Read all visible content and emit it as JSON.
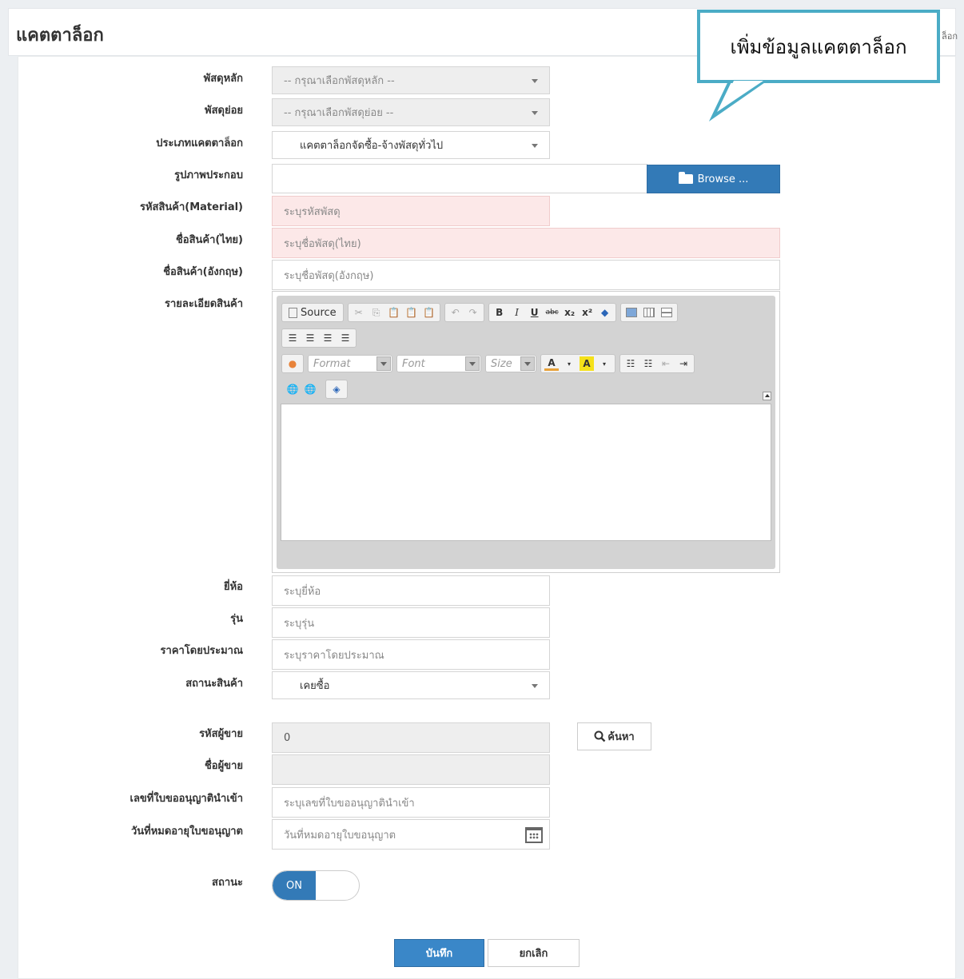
{
  "header": {
    "title": "แคตตาล็อก",
    "breadcrumb_tail": "ล็อก"
  },
  "callout": {
    "text": "เพิ่มข้อมูลแคตตาล็อก"
  },
  "form": {
    "main_item": {
      "label": "พัสดุหลัก",
      "placeholder": "-- กรุณาเลือกพัสดุหลัก --"
    },
    "sub_item": {
      "label": "พัสดุย่อย",
      "placeholder": "-- กรุณาเลือกพัสดุย่อย --"
    },
    "catalog_type": {
      "label": "ประเภทแคตตาล็อก",
      "value": "แคตตาล็อกจัดซื้อ-จ้างพัสดุทั่วไป"
    },
    "image": {
      "label": "รูปภาพประกอบ",
      "browse_label": "Browse ..."
    },
    "material_code": {
      "label": "รหัสสินค้า(Material)",
      "placeholder": "ระบุรหัสพัสดุ"
    },
    "name_th": {
      "label": "ชื่อสินค้า(ไทย)",
      "placeholder": "ระบุชื่อพัสดุ(ไทย)"
    },
    "name_en": {
      "label": "ชื่อสินค้า(อังกฤษ)",
      "placeholder": "ระบุชื่อพัสดุ(อังกฤษ)"
    },
    "details": {
      "label": "รายละเอียดสินค้า"
    },
    "brand": {
      "label": "ยี่ห้อ",
      "placeholder": "ระบุยี่ห้อ"
    },
    "model": {
      "label": "รุ่น",
      "placeholder": "ระบุรุ่น"
    },
    "price": {
      "label": "ราคาโดยประมาณ",
      "placeholder": "ระบุราคาโดยประมาณ"
    },
    "product_status": {
      "label": "สถานะสินค้า",
      "value": "เคยซื้อ"
    },
    "vendor_code": {
      "label": "รหัสผู้ขาย",
      "value": "0",
      "search_label": "ค้นหา"
    },
    "vendor_name": {
      "label": "ชื่อผู้ขาย",
      "value": ""
    },
    "license_no": {
      "label": "เลขที่ใบขออนุญาตินำเข้า",
      "placeholder": "ระบุเลขที่ใบขออนุญาตินำเข้า"
    },
    "license_expiry": {
      "label": "วันที่หมดอายุใบขอนุญาต",
      "placeholder": "วันที่หมดอายุใบขอนุญาต"
    },
    "status": {
      "label": "สถานะ",
      "toggle_label": "ON",
      "enabled": true
    }
  },
  "editor": {
    "source_label": "Source",
    "format_label": "Format",
    "font_label": "Font",
    "size_label": "Size"
  },
  "actions": {
    "save_label": "บันทึก",
    "cancel_label": "ยกเลิก"
  },
  "colors": {
    "primary": "#337ab7",
    "required_bg": "#fce8e8",
    "callout_border": "#4bacc6",
    "readonly_bg": "#eeeeee"
  }
}
